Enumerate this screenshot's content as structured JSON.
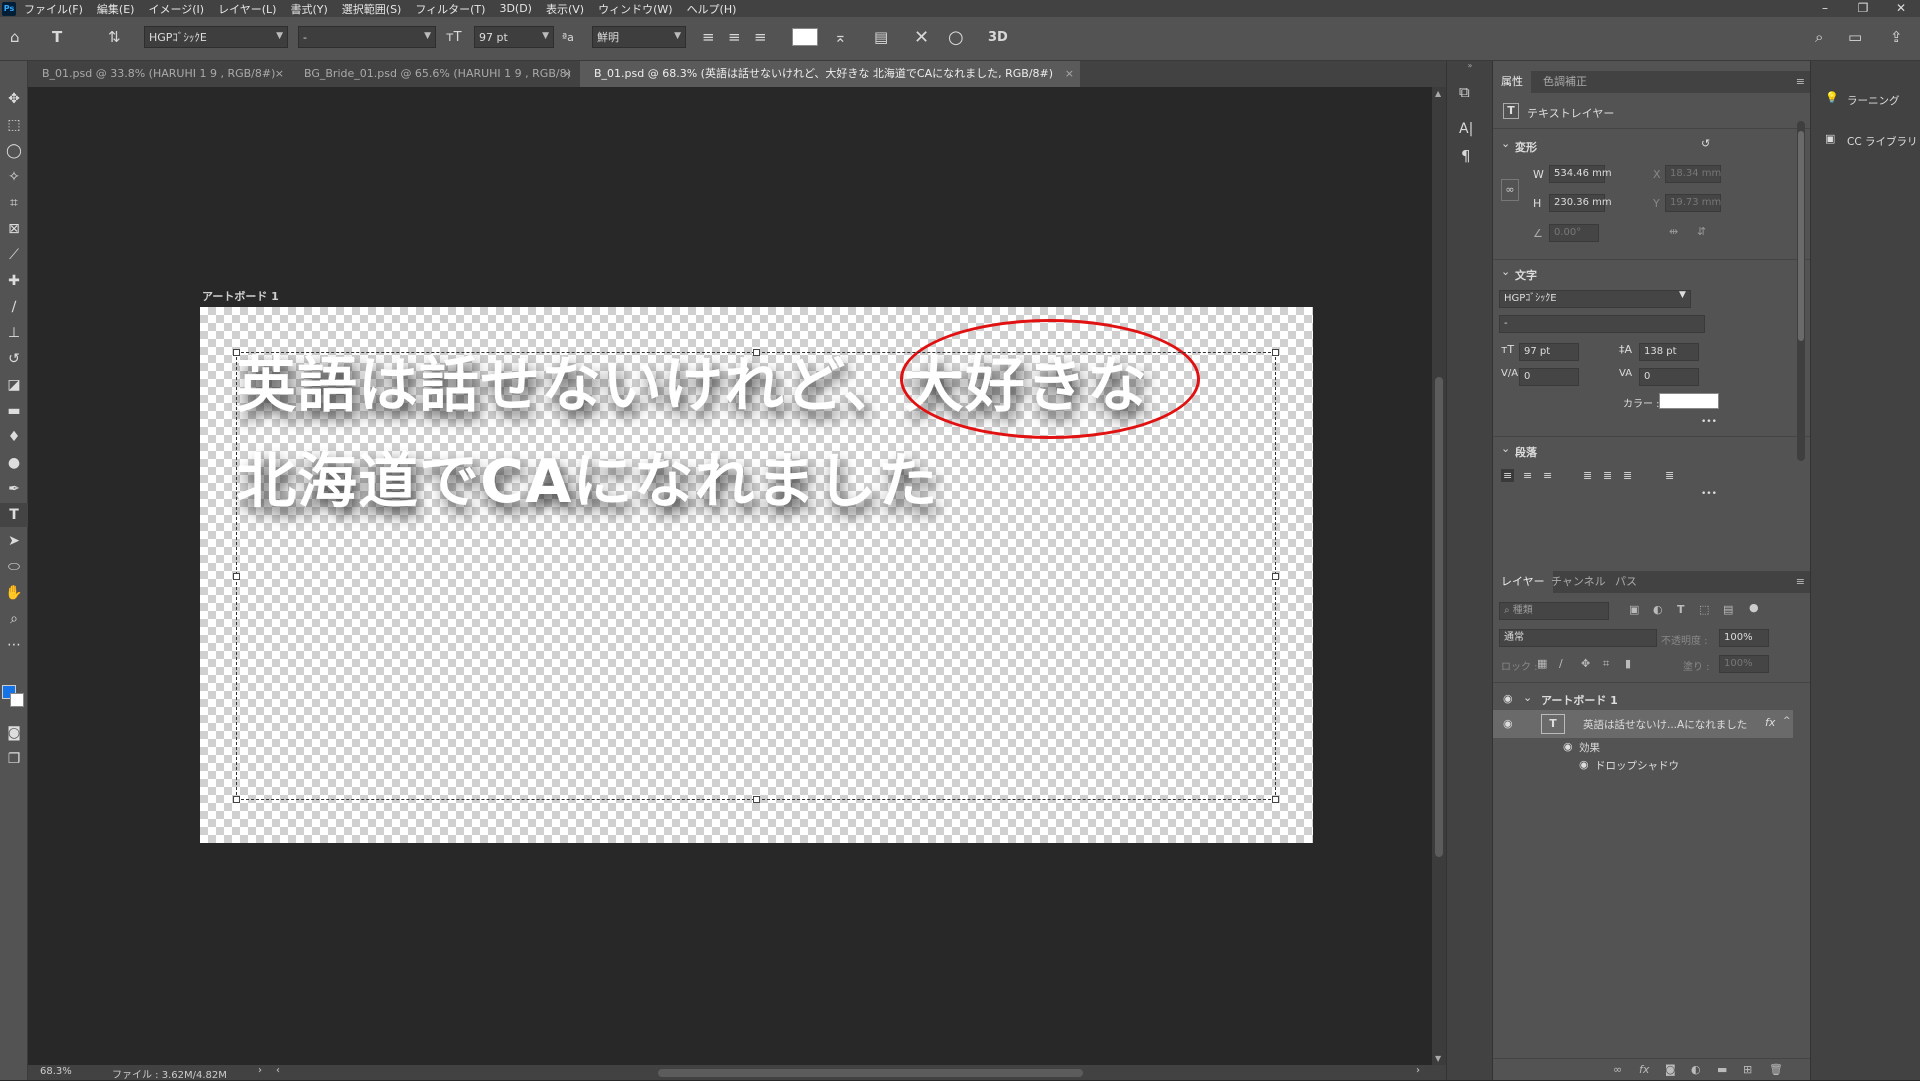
{
  "menubar": {
    "logo": "Ps",
    "items": [
      "ファイル(F)",
      "編集(E)",
      "イメージ(I)",
      "レイヤー(L)",
      "書式(Y)",
      "選択範囲(S)",
      "フィルター(T)",
      "3D(D)",
      "表示(V)",
      "ウィンドウ(W)",
      "ヘルプ(H)"
    ],
    "window_controls": [
      "–",
      "❐",
      "✕"
    ]
  },
  "options": {
    "font_family": "HGPｺﾞｼｯｸE",
    "font_style": "-",
    "font_size": "97 pt",
    "antialias_icon": "ªa",
    "antialias": "鮮明",
    "three_d": "3D"
  },
  "tabs": [
    {
      "label": "B_01.psd @ 33.8% (HARUHI 1 9 , RGB/8#)",
      "close": "×"
    },
    {
      "label": "BG_Bride_01.psd @ 65.6% (HARUHI 1 9 , RGB/8)",
      "close": "×"
    },
    {
      "label": "B_01.psd @ 68.3% (英語は話せないけれど、大好きな 北海道でCAになれました, RGB/8#)",
      "close": "×"
    }
  ],
  "canvas": {
    "artboard_label": "アートボード 1",
    "line1": "英語は話せないけれど、大好きな",
    "line2": "北海道でCAになれました"
  },
  "status": {
    "zoom": "68.3%",
    "file": "ファイル : 3.62M/4.82M",
    "arrow": "›",
    "left_arrow": "‹",
    "right_arrow": "›"
  },
  "properties": {
    "tabs": [
      "属性",
      "色調補正"
    ],
    "layer_type": "テキストレイヤー",
    "transform": {
      "title": "変形",
      "w_label": "W",
      "w": "534.46 mm",
      "h_label": "H",
      "h": "230.36 mm",
      "x_label": "X",
      "x": "18.34 mm",
      "y_label": "Y",
      "y": "19.73 mm",
      "angle": "0.00°"
    },
    "character": {
      "title": "文字",
      "font": "HGPｺﾞｼｯｸE",
      "style": "-",
      "size": "97 pt",
      "leading": "138 pt",
      "kerning": "0",
      "tracking": "0",
      "color_label": "カラー :",
      "more": "•••"
    },
    "paragraph": {
      "title": "段落",
      "more": "•••"
    }
  },
  "layers": {
    "tabs": [
      "レイヤー",
      "チャンネル",
      "パス"
    ],
    "search_placeholder": "種類",
    "blend_mode": "通常",
    "opacity_label": "不透明度 :",
    "opacity": "100%",
    "lock_label": "ロック :",
    "fill_label": "塗り :",
    "fill": "100%",
    "rows": [
      {
        "name": "アートボード 1"
      },
      {
        "name": "英語は話せないけ...Aになれました",
        "fx": "fx"
      },
      {
        "name": "効果"
      },
      {
        "name": "ドロップシャドウ"
      }
    ]
  },
  "far_right": {
    "items": [
      "ラーニング",
      "CC ライブラリ"
    ]
  },
  "colors": {
    "ellipse": "#e11111",
    "foreground": "#1473e6",
    "text_color": "#ffffff"
  }
}
